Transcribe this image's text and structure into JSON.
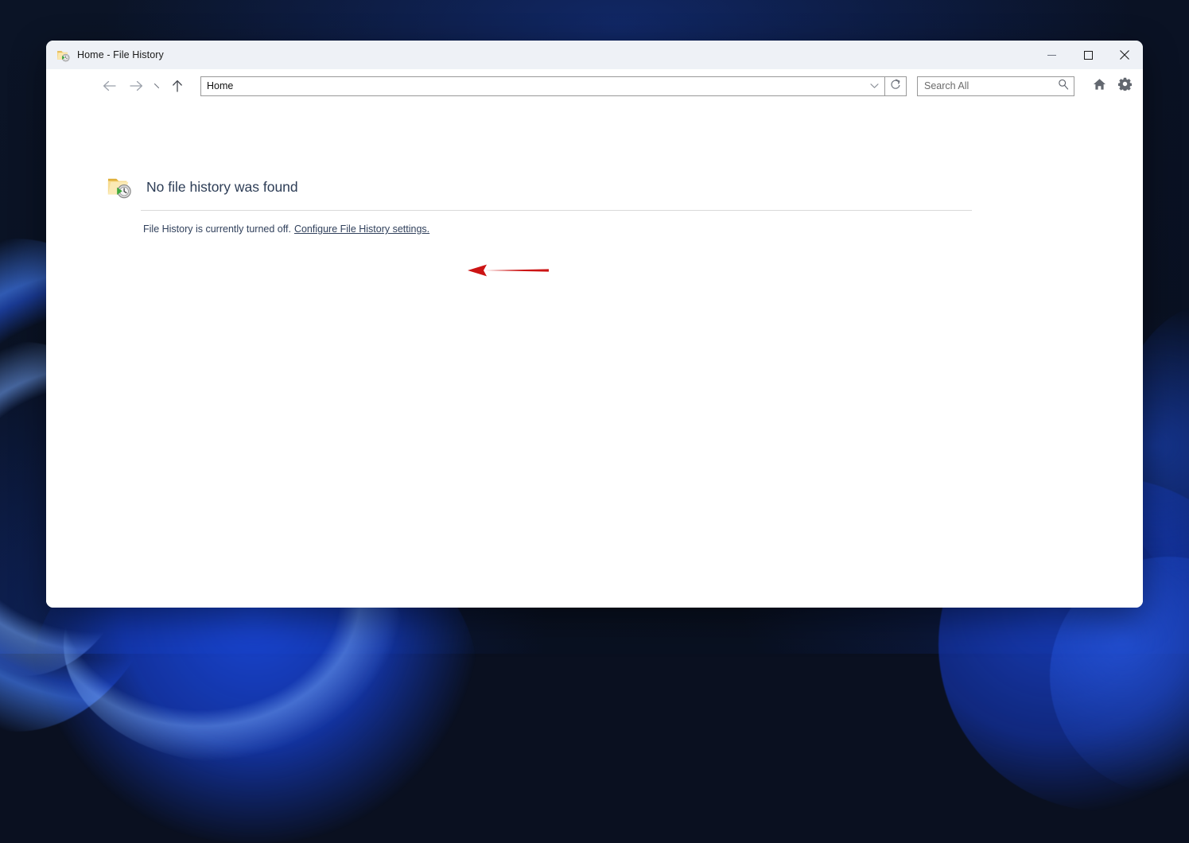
{
  "window": {
    "title": "Home - File History",
    "title_icon": "folder-history-icon",
    "controls": {
      "minimize": "minimize-icon",
      "maximize": "maximize-icon",
      "close": "close-icon"
    }
  },
  "toolbar": {
    "back_icon": "arrow-left-icon",
    "forward_icon": "arrow-right-icon",
    "recent_icon": "chevron-recent-icon",
    "up_icon": "arrow-up-icon",
    "address": {
      "value": "Home",
      "dropdown_icon": "chevron-down-icon"
    },
    "refresh_icon": "refresh-icon",
    "search": {
      "placeholder": "Search All",
      "value": "Search All",
      "icon": "search-icon"
    },
    "home_icon": "home-icon",
    "settings_icon": "gear-icon"
  },
  "content": {
    "icon": "folder-history-icon",
    "headline": "No file history was found",
    "status_text": "File History is currently turned off.",
    "link_text": "Configure File History settings."
  },
  "annotation": {
    "arrow": "red-left-arrow",
    "color": "#cc1414"
  },
  "colors": {
    "titlebar_bg": "#eef1f6",
    "window_bg": "#ffffff",
    "heading_text": "#2d3d56",
    "body_text": "#31415c",
    "divider": "#d9d9d9",
    "desktop_bg": "#0a1020",
    "accent_blue": "#2b6bff"
  }
}
